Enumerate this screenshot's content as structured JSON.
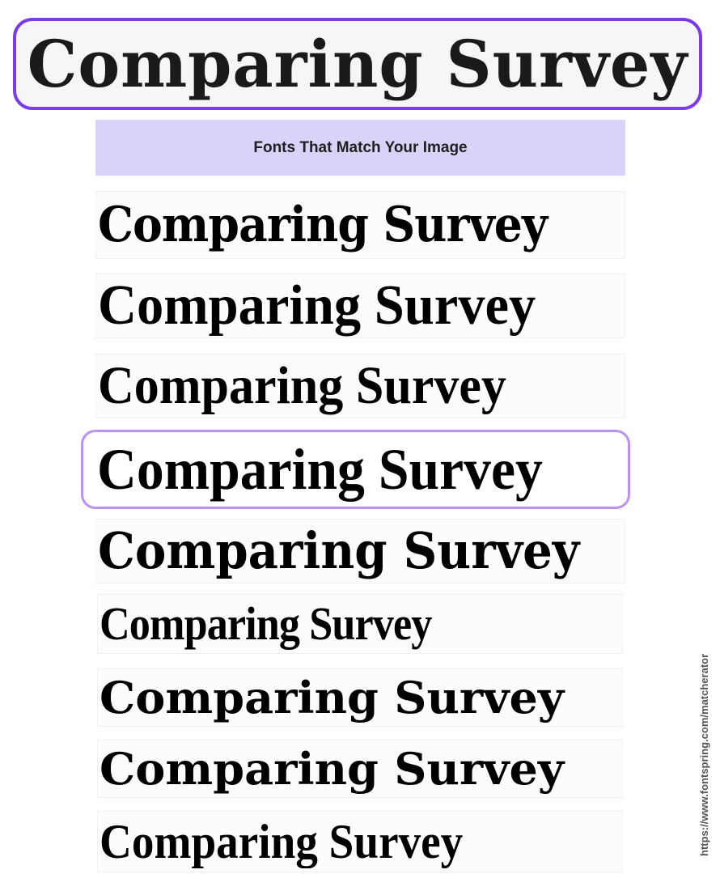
{
  "source_image": {
    "text": "Comparing Survey"
  },
  "header": {
    "title": "Fonts That Match Your Image"
  },
  "matches": [
    {
      "text": "Comparing Survey",
      "selected": false
    },
    {
      "text": "Comparing Survey",
      "selected": false
    },
    {
      "text": "Comparing Survey",
      "selected": false
    },
    {
      "text": "Comparing Survey",
      "selected": true
    },
    {
      "text": "Comparing Survey",
      "selected": false
    },
    {
      "text": "Comparing Survey",
      "selected": false
    },
    {
      "text": "Comparing Survey",
      "selected": false
    },
    {
      "text": "Comparing Survey",
      "selected": false
    },
    {
      "text": "Comparing Survey",
      "selected": false
    }
  ],
  "footer": {
    "url": "https://www.fontspring.com/matcherator"
  },
  "colors": {
    "accent": "#7c3aed",
    "selected_border": "#b794f4",
    "header_bg": "#d9d3f9"
  }
}
